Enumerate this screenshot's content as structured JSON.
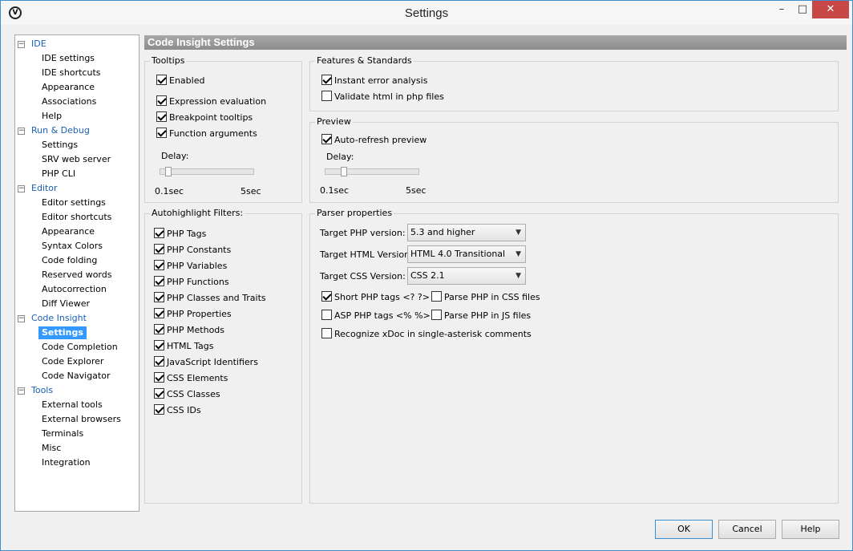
{
  "window": {
    "title": "Settings",
    "app_icon": "V",
    "minimize": "–",
    "maximize": "□",
    "close": "✕"
  },
  "sidebar": {
    "groups": [
      {
        "label": "IDE",
        "toggle": "−",
        "items": [
          "IDE settings",
          "IDE shortcuts",
          "Appearance",
          "Associations",
          "Help"
        ]
      },
      {
        "label": "Run & Debug",
        "toggle": "−",
        "items": [
          "Settings",
          "SRV web server",
          "PHP CLI"
        ]
      },
      {
        "label": "Editor",
        "toggle": "−",
        "items": [
          "Editor settings",
          "Editor shortcuts",
          "Appearance",
          "Syntax Colors",
          "Code folding",
          "Reserved words",
          "Autocorrection",
          "Diff Viewer"
        ]
      },
      {
        "label": "Code Insight",
        "toggle": "−",
        "items": [
          "Settings",
          "Code Completion",
          "Code Explorer",
          "Code Navigator"
        ]
      },
      {
        "label": "Tools",
        "toggle": "−",
        "items": [
          "External tools",
          "External browsers",
          "Terminals",
          "Misc",
          "Integration"
        ]
      }
    ],
    "selected": "Code Insight/Settings"
  },
  "main": {
    "header": "Code Insight Settings",
    "tooltips": {
      "title": "Tooltips",
      "enabled": {
        "label": "Enabled",
        "checked": true
      },
      "options": [
        {
          "label": "Expression evaluation",
          "checked": true
        },
        {
          "label": "Breakpoint tooltips",
          "checked": true
        },
        {
          "label": "Function arguments",
          "checked": true
        }
      ],
      "delay_label": "Delay:",
      "delay_min": "0.1sec",
      "delay_max": "5sec",
      "delay_value": 0.1
    },
    "features": {
      "title": "Features & Standards",
      "options": [
        {
          "label": "Instant error analysis",
          "checked": true
        },
        {
          "label": "Validate html in php files",
          "checked": false
        }
      ]
    },
    "preview": {
      "title": "Preview",
      "auto_refresh": {
        "label": "Auto-refresh preview",
        "checked": true
      },
      "delay_label": "Delay:",
      "delay_min": "0.1sec",
      "delay_max": "5sec",
      "delay_value": 0.1
    },
    "autohighlight": {
      "title": "Autohighlight Filters:",
      "options": [
        {
          "label": "PHP Tags",
          "checked": true
        },
        {
          "label": "PHP Constants",
          "checked": true
        },
        {
          "label": "PHP Variables",
          "checked": true
        },
        {
          "label": "PHP Functions",
          "checked": true
        },
        {
          "label": "PHP Classes and Traits",
          "checked": true
        },
        {
          "label": "PHP Properties",
          "checked": true
        },
        {
          "label": "PHP Methods",
          "checked": true
        },
        {
          "label": "HTML Tags",
          "checked": true
        },
        {
          "label": "JavaScript Identifiers",
          "checked": true
        },
        {
          "label": "CSS Elements",
          "checked": true
        },
        {
          "label": "CSS Classes",
          "checked": true
        },
        {
          "label": "CSS IDs",
          "checked": true
        }
      ]
    },
    "parser": {
      "title": "Parser properties",
      "php_version_label": "Target PHP version:",
      "php_version_value": "5.3 and higher",
      "html_version_label": "Target HTML Version:",
      "html_version_value": "HTML 4.0 Transitional",
      "css_version_label": "Target CSS Version:",
      "css_version_value": "CSS 2.1",
      "short_php_tags": {
        "label": "Short PHP tags <? ?>",
        "checked": true
      },
      "parse_php_css": {
        "label": "Parse PHP in CSS files",
        "checked": false
      },
      "asp_php_tags": {
        "label": "ASP PHP tags <% %>",
        "checked": false
      },
      "parse_php_js": {
        "label": "Parse PHP in JS files",
        "checked": false
      },
      "recognize_xdoc": {
        "label": "Recognize xDoc in single-asterisk comments",
        "checked": false
      }
    }
  },
  "footer": {
    "ok": "OK",
    "cancel": "Cancel",
    "help": "Help"
  }
}
